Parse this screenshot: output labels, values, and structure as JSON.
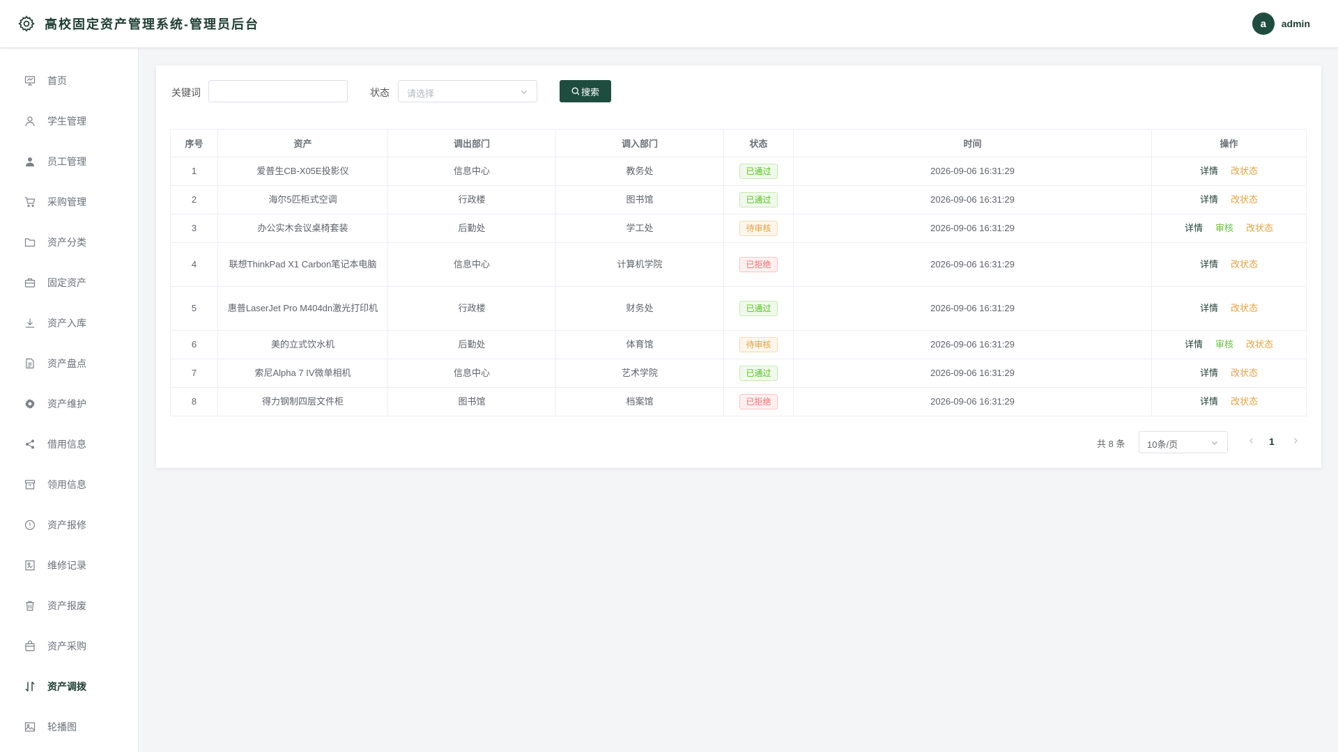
{
  "app": {
    "title": "高校固定资产管理系统-管理员后台",
    "user_initial": "a",
    "username": "admin"
  },
  "sidebar": {
    "items": [
      {
        "label": "首页",
        "icon": "dashboard-icon"
      },
      {
        "label": "学生管理",
        "icon": "user-icon"
      },
      {
        "label": "员工管理",
        "icon": "user-filled-icon"
      },
      {
        "label": "采购管理",
        "icon": "cart-icon"
      },
      {
        "label": "资产分类",
        "icon": "folder-icon"
      },
      {
        "label": "固定资产",
        "icon": "briefcase-icon"
      },
      {
        "label": "资产入库",
        "icon": "download-icon"
      },
      {
        "label": "资产盘点",
        "icon": "document-icon"
      },
      {
        "label": "资产维护",
        "icon": "gear-icon"
      },
      {
        "label": "借用信息",
        "icon": "share-icon"
      },
      {
        "label": "领用信息",
        "icon": "box-icon"
      },
      {
        "label": "资产报修",
        "icon": "warning-icon"
      },
      {
        "label": "维修记录",
        "icon": "record-icon"
      },
      {
        "label": "资产报废",
        "icon": "trash-icon"
      },
      {
        "label": "资产采购",
        "icon": "bag-icon"
      },
      {
        "label": "资产调拨",
        "icon": "transfer-icon",
        "active": true
      },
      {
        "label": "轮播图",
        "icon": "picture-icon"
      }
    ]
  },
  "filters": {
    "keyword_label": "关键词",
    "keyword_value": "",
    "status_label": "状态",
    "status_placeholder": "请选择",
    "search_button": "搜索"
  },
  "table": {
    "columns": [
      "序号",
      "资产",
      "调出部门",
      "调入部门",
      "状态",
      "时间",
      "操作"
    ],
    "rows": [
      {
        "no": "1",
        "asset": "爱普生CB-X05E投影仪",
        "from": "信息中心",
        "to": "教务处",
        "status": "已通过",
        "status_type": "pass",
        "time": "2026-09-06 16:31:29",
        "ops": [
          "详情",
          "改状态"
        ]
      },
      {
        "no": "2",
        "asset": "海尔5匹柜式空调",
        "from": "行政楼",
        "to": "图书馆",
        "status": "已通过",
        "status_type": "pass",
        "time": "2026-09-06 16:31:29",
        "ops": [
          "详情",
          "改状态"
        ]
      },
      {
        "no": "3",
        "asset": "办公实木会议桌椅套装",
        "from": "后勤处",
        "to": "学工处",
        "status": "待审核",
        "status_type": "pending",
        "time": "2026-09-06 16:31:29",
        "ops": [
          "详情",
          "审核",
          "改状态"
        ]
      },
      {
        "no": "4",
        "asset": "联想ThinkPad X1 Carbon笔记本电脑",
        "from": "信息中心",
        "to": "计算机学院",
        "status": "已拒绝",
        "status_type": "reject",
        "time": "2026-09-06 16:31:29",
        "ops": [
          "详情",
          "改状态"
        ]
      },
      {
        "no": "5",
        "asset": "惠普LaserJet Pro M404dn激光打印机",
        "from": "行政楼",
        "to": "财务处",
        "status": "已通过",
        "status_type": "pass",
        "time": "2026-09-06 16:31:29",
        "ops": [
          "详情",
          "改状态"
        ]
      },
      {
        "no": "6",
        "asset": "美的立式饮水机",
        "from": "后勤处",
        "to": "体育馆",
        "status": "待审核",
        "status_type": "pending",
        "time": "2026-09-06 16:31:29",
        "ops": [
          "详情",
          "审核",
          "改状态"
        ]
      },
      {
        "no": "7",
        "asset": "索尼Alpha 7 IV微单相机",
        "from": "信息中心",
        "to": "艺术学院",
        "status": "已通过",
        "status_type": "pass",
        "time": "2026-09-06 16:31:29",
        "ops": [
          "详情",
          "改状态"
        ]
      },
      {
        "no": "8",
        "asset": "得力钢制四层文件柜",
        "from": "图书馆",
        "to": "档案馆",
        "status": "已拒绝",
        "status_type": "reject",
        "time": "2026-09-06 16:31:29",
        "ops": [
          "详情",
          "改状态"
        ]
      }
    ]
  },
  "pagination": {
    "total_text": "共 8 条",
    "page_size": "10条/页",
    "current_page": "1"
  },
  "colors": {
    "primary": "#1e4d3f",
    "pass": "#52c41a",
    "pending": "#e6a23c",
    "reject": "#f56c6c"
  }
}
